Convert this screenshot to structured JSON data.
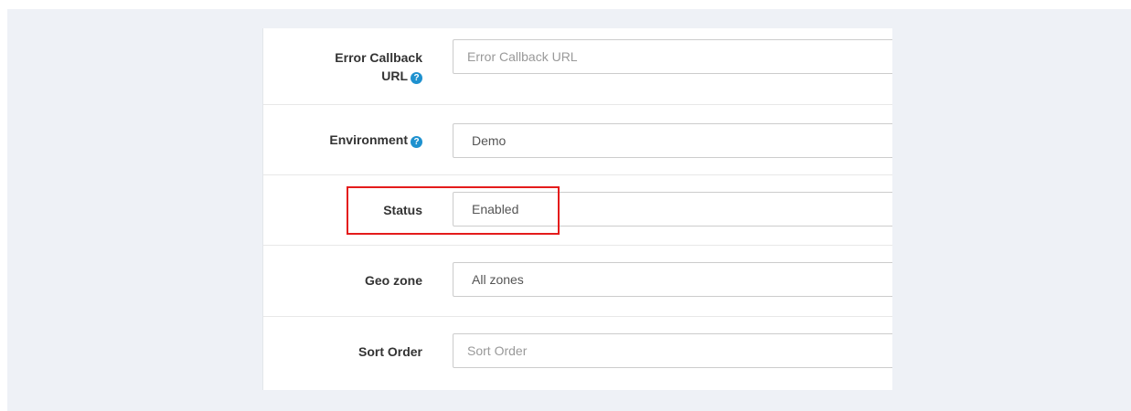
{
  "form": {
    "error_callback_url": {
      "label_line1": "Error Callback",
      "label_line2": "URL",
      "placeholder": "Error Callback URL"
    },
    "environment": {
      "label": "Environment",
      "value": "Demo"
    },
    "status": {
      "label": "Status",
      "value": "Enabled"
    },
    "geo_zone": {
      "label": "Geo zone",
      "value": "All zones"
    },
    "sort_order": {
      "label": "Sort Order",
      "placeholder": "Sort Order"
    }
  },
  "help_icon_glyph": "?",
  "colors": {
    "help_icon": "#1e91cf",
    "highlight": "#e41b1b",
    "background": "#eef1f6"
  }
}
